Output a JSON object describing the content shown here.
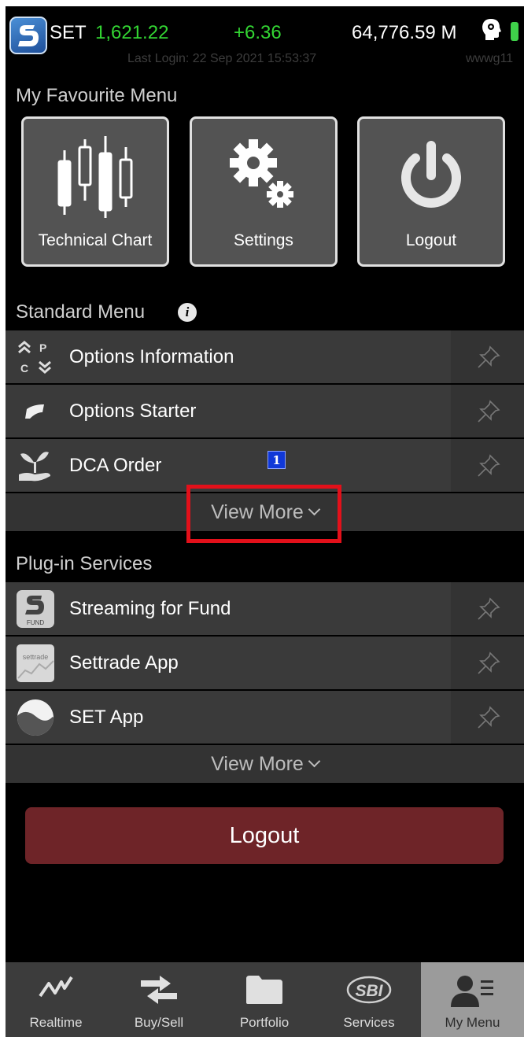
{
  "ticker": {
    "market": "SET",
    "index": "1,621.22",
    "change": "+6.36",
    "volume": "64,776.59 M",
    "last_login": "Last Login: 22 Sep 2021 15:53:37",
    "user": "wwwg11",
    "index_color": "#33d633"
  },
  "favourite": {
    "title": "My Favourite Menu",
    "tiles": [
      {
        "label": "Technical Chart",
        "icon": "candlestick-icon"
      },
      {
        "label": "Settings",
        "icon": "gears-icon"
      },
      {
        "label": "Logout",
        "icon": "power-icon"
      }
    ]
  },
  "standard": {
    "title": "Standard Menu",
    "items": [
      {
        "label": "Options Information",
        "icon": "options-cp-icon"
      },
      {
        "label": "Options Starter",
        "icon": "options-starter-icon"
      },
      {
        "label": "DCA Order",
        "icon": "plant-hand-icon"
      }
    ],
    "badge": "1",
    "view_more": "View More"
  },
  "plugins": {
    "title": "Plug-in Services",
    "items": [
      {
        "label": "Streaming for Fund",
        "icon": "streaming-fund-icon",
        "icon_text": "FUND"
      },
      {
        "label": "Settrade App",
        "icon": "settrade-app-icon",
        "icon_text": "settrade"
      },
      {
        "label": "SET App",
        "icon": "set-app-icon"
      }
    ],
    "view_more": "View More"
  },
  "logout_button": "Logout",
  "tabs": [
    {
      "label": "Realtime",
      "icon": "realtime-icon",
      "active": false
    },
    {
      "label": "Buy/Sell",
      "icon": "buy-sell-icon",
      "active": false
    },
    {
      "label": "Portfolio",
      "icon": "folder-icon",
      "active": false
    },
    {
      "label": "Services",
      "icon": "sbi-icon",
      "icon_text": "SBI",
      "active": false
    },
    {
      "label": "My Menu",
      "icon": "user-list-icon",
      "active": true
    }
  ],
  "colors": {
    "accent_green": "#33d633",
    "logout_red": "#6e2428",
    "highlight": "#e3101a",
    "badge_blue": "#1038d8"
  }
}
